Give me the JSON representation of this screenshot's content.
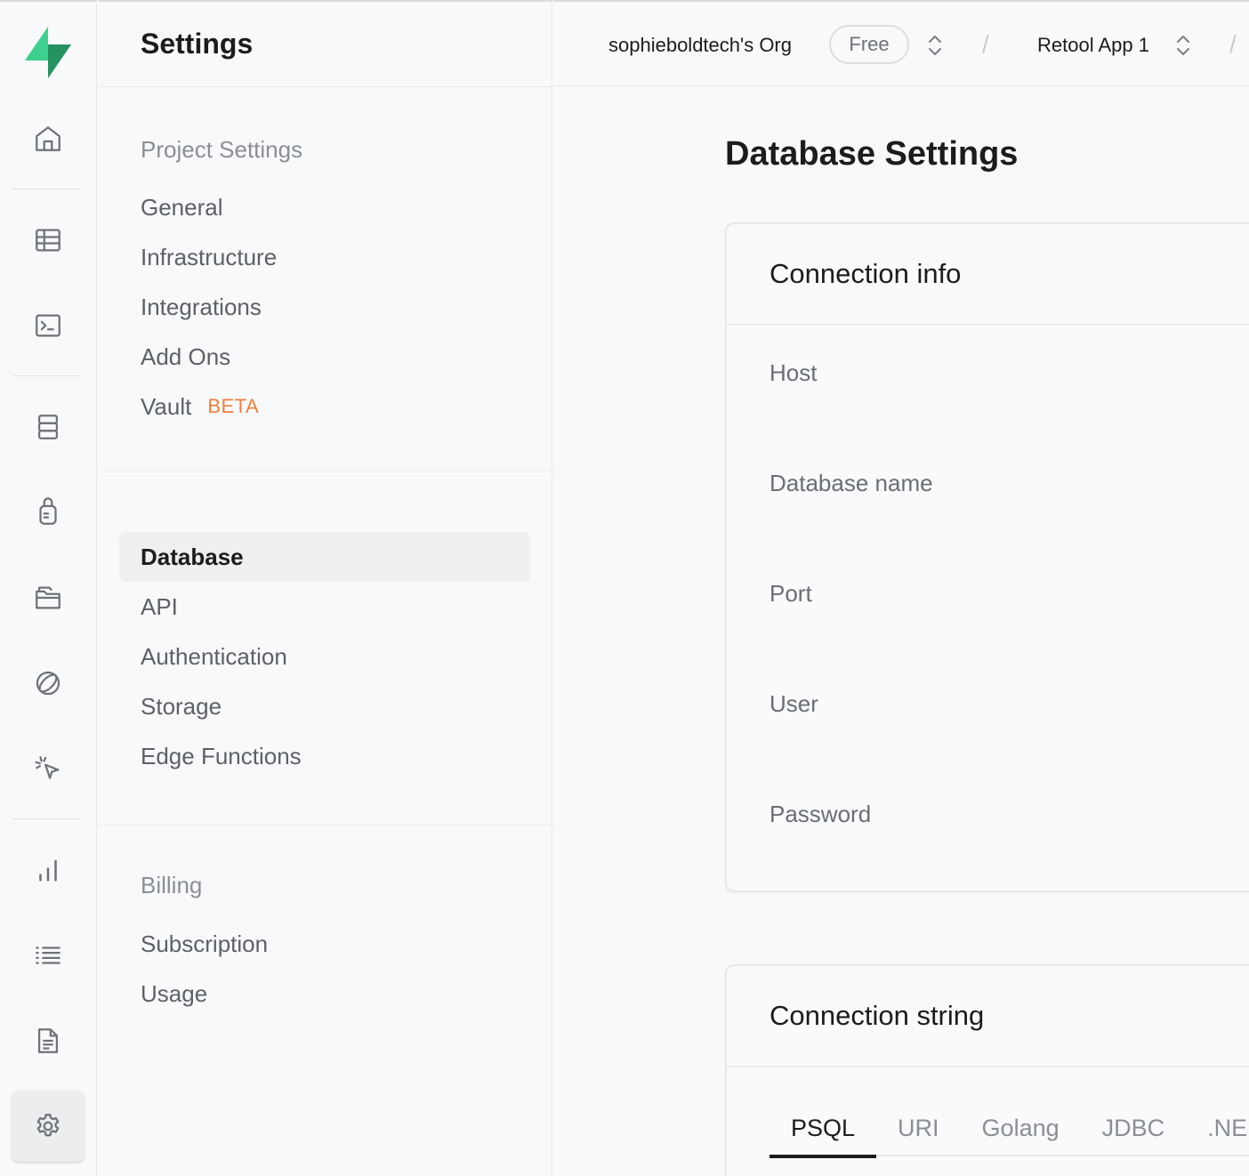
{
  "header": {
    "settings_title": "Settings",
    "org_name": "sophieboldtech's Org",
    "plan_badge": "Free",
    "project_name": "Retool App 1"
  },
  "rail": {
    "icons": [
      "logo-icon",
      "home-icon",
      "table-editor-icon",
      "sql-editor-icon",
      "database-icon",
      "authentication-icon",
      "storage-icon",
      "realtime-icon",
      "edge-functions-icon",
      "reports-icon",
      "logs-icon",
      "api-docs-icon",
      "settings-icon"
    ],
    "active": "settings-icon",
    "brand_color": "#3ecf8e"
  },
  "menu": {
    "project_settings": {
      "label": "Project Settings",
      "items": [
        "General",
        "Infrastructure",
        "Integrations",
        "Add Ons",
        "Vault"
      ],
      "vault_badge": "BETA"
    },
    "configuration": {
      "items": [
        "Database",
        "API",
        "Authentication",
        "Storage",
        "Edge Functions"
      ],
      "active": "Database"
    },
    "billing": {
      "label": "Billing",
      "items": [
        "Subscription",
        "Usage"
      ]
    }
  },
  "main": {
    "page_title": "Database Settings",
    "connection_info": {
      "title": "Connection info",
      "fields": [
        "Host",
        "Database name",
        "Port",
        "User",
        "Password"
      ]
    },
    "connection_string": {
      "title": "Connection string",
      "tabs": [
        "PSQL",
        "URI",
        "Golang",
        "JDBC",
        ".NE"
      ],
      "active_tab": "PSQL"
    }
  },
  "colors": {
    "accent_beta": "#f07f3c",
    "text_primary": "#1c1c1c",
    "text_muted": "#6a6e73"
  }
}
